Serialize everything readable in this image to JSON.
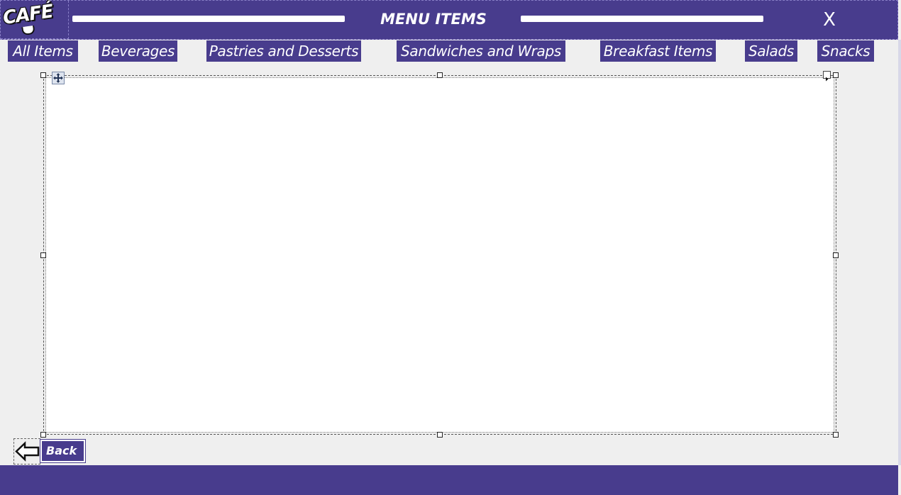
{
  "header": {
    "logo_text": "CAFÉ",
    "title": "MENU ITEMS",
    "close_label": "X"
  },
  "tabs": [
    {
      "label": "All Items"
    },
    {
      "label": "Beverages"
    },
    {
      "label": "Pastries and Desserts"
    },
    {
      "label": "Sandwiches and Wraps"
    },
    {
      "label": "Breakfast Items"
    },
    {
      "label": "Salads"
    },
    {
      "label": "Snacks"
    }
  ],
  "content": {
    "icons": [
      "move-handle-icon",
      "expand-arrow-icon"
    ]
  },
  "footer": {
    "back_label": "Back",
    "back_icon": "left-arrow-icon"
  },
  "colors": {
    "primary": "#483c8d",
    "background": "#efefef",
    "content": "#ffffff"
  }
}
